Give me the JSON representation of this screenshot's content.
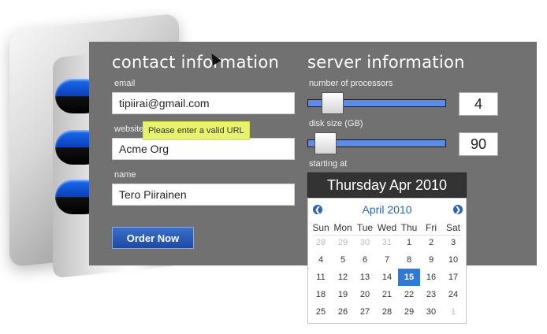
{
  "contact": {
    "title": "contact information",
    "email_label": "email",
    "email_value": "tipiirai@gmail.com",
    "website_label": "website",
    "website_value": "Acme Org",
    "tooltip": "Please enter a valid URL",
    "name_label": "name",
    "name_value": "Tero Piirainen",
    "order_button": "Order Now"
  },
  "server": {
    "title": "server information",
    "processors_label": "number of processors",
    "processors_value": "4",
    "processors_fraction": 0.12,
    "disk_label": "disk size (GB)",
    "disk_value": "90",
    "disk_fraction": 0.06,
    "starting_label": "starting at",
    "starting_value": "Thursday Apr 2010"
  },
  "calendar": {
    "month_label": "April 2010",
    "prev_icon": "chevron-left-icon",
    "next_icon": "chevron-right-icon",
    "weekdays": [
      "Sun",
      "Mon",
      "Tue",
      "Wed",
      "Thu",
      "Fri",
      "Sat"
    ],
    "weeks": [
      [
        "28",
        "29",
        "30",
        "31",
        "1",
        "2",
        "3"
      ],
      [
        "4",
        "5",
        "6",
        "7",
        "8",
        "9",
        "10"
      ],
      [
        "11",
        "12",
        "13",
        "14",
        "15",
        "16",
        "17"
      ],
      [
        "18",
        "19",
        "20",
        "21",
        "22",
        "23",
        "24"
      ],
      [
        "25",
        "26",
        "27",
        "28",
        "29",
        "30",
        "1"
      ]
    ],
    "muted_cells": [
      [
        0,
        0
      ],
      [
        0,
        1
      ],
      [
        0,
        2
      ],
      [
        0,
        3
      ],
      [
        4,
        6
      ]
    ],
    "selected_cell": [
      2,
      4
    ],
    "accent_color": "#2f7ad9"
  }
}
